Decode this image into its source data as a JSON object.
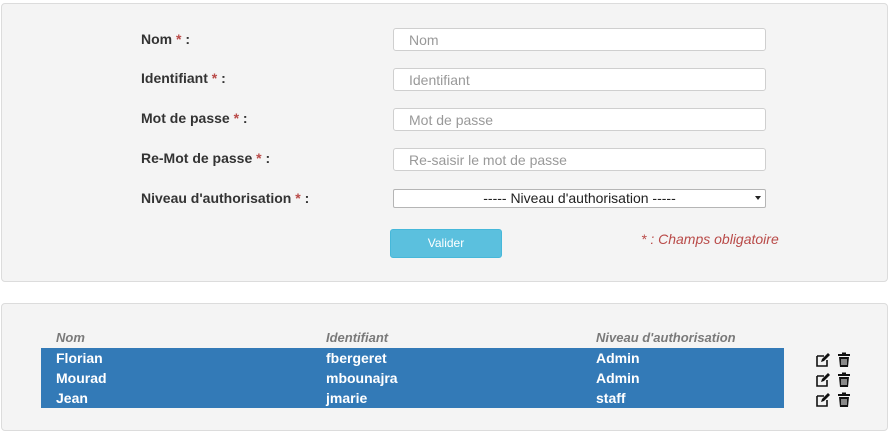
{
  "form": {
    "fields": [
      {
        "label": "Nom",
        "required_mark": "*",
        "suffix": " :",
        "placeholder": "Nom",
        "value": ""
      },
      {
        "label": "Identifiant",
        "required_mark": "*",
        "suffix": " :",
        "placeholder": "Identifiant",
        "value": ""
      },
      {
        "label": "Mot de passe",
        "required_mark": "*",
        "suffix": " :",
        "placeholder": "Mot de passe",
        "value": ""
      },
      {
        "label": "Re-Mot de passe",
        "required_mark": "*",
        "suffix": " :",
        "placeholder": "Re-saisir le mot de passe",
        "value": ""
      },
      {
        "label": "Niveau d'authorisation",
        "required_mark": "*",
        "suffix": " :"
      }
    ],
    "select_value": "----- Niveau d'authorisation -----",
    "submit_label": "Valider",
    "required_note": "* : Champs obligatoire"
  },
  "table": {
    "headers": [
      "Nom",
      "Identifiant",
      "Niveau d'authorisation"
    ],
    "rows": [
      {
        "nom": "Florian",
        "identifiant": "fbergeret",
        "niveau": "Admin"
      },
      {
        "nom": "Mourad",
        "identifiant": "mbounajra",
        "niveau": "Admin"
      },
      {
        "nom": "Jean",
        "identifiant": "jmarie",
        "niveau": "staff"
      }
    ],
    "row_actions": [
      "edit-icon",
      "trash-icon"
    ]
  },
  "colors": {
    "accent_row": "#337ab7",
    "button": "#5bc0de",
    "required": "#b94a48"
  }
}
